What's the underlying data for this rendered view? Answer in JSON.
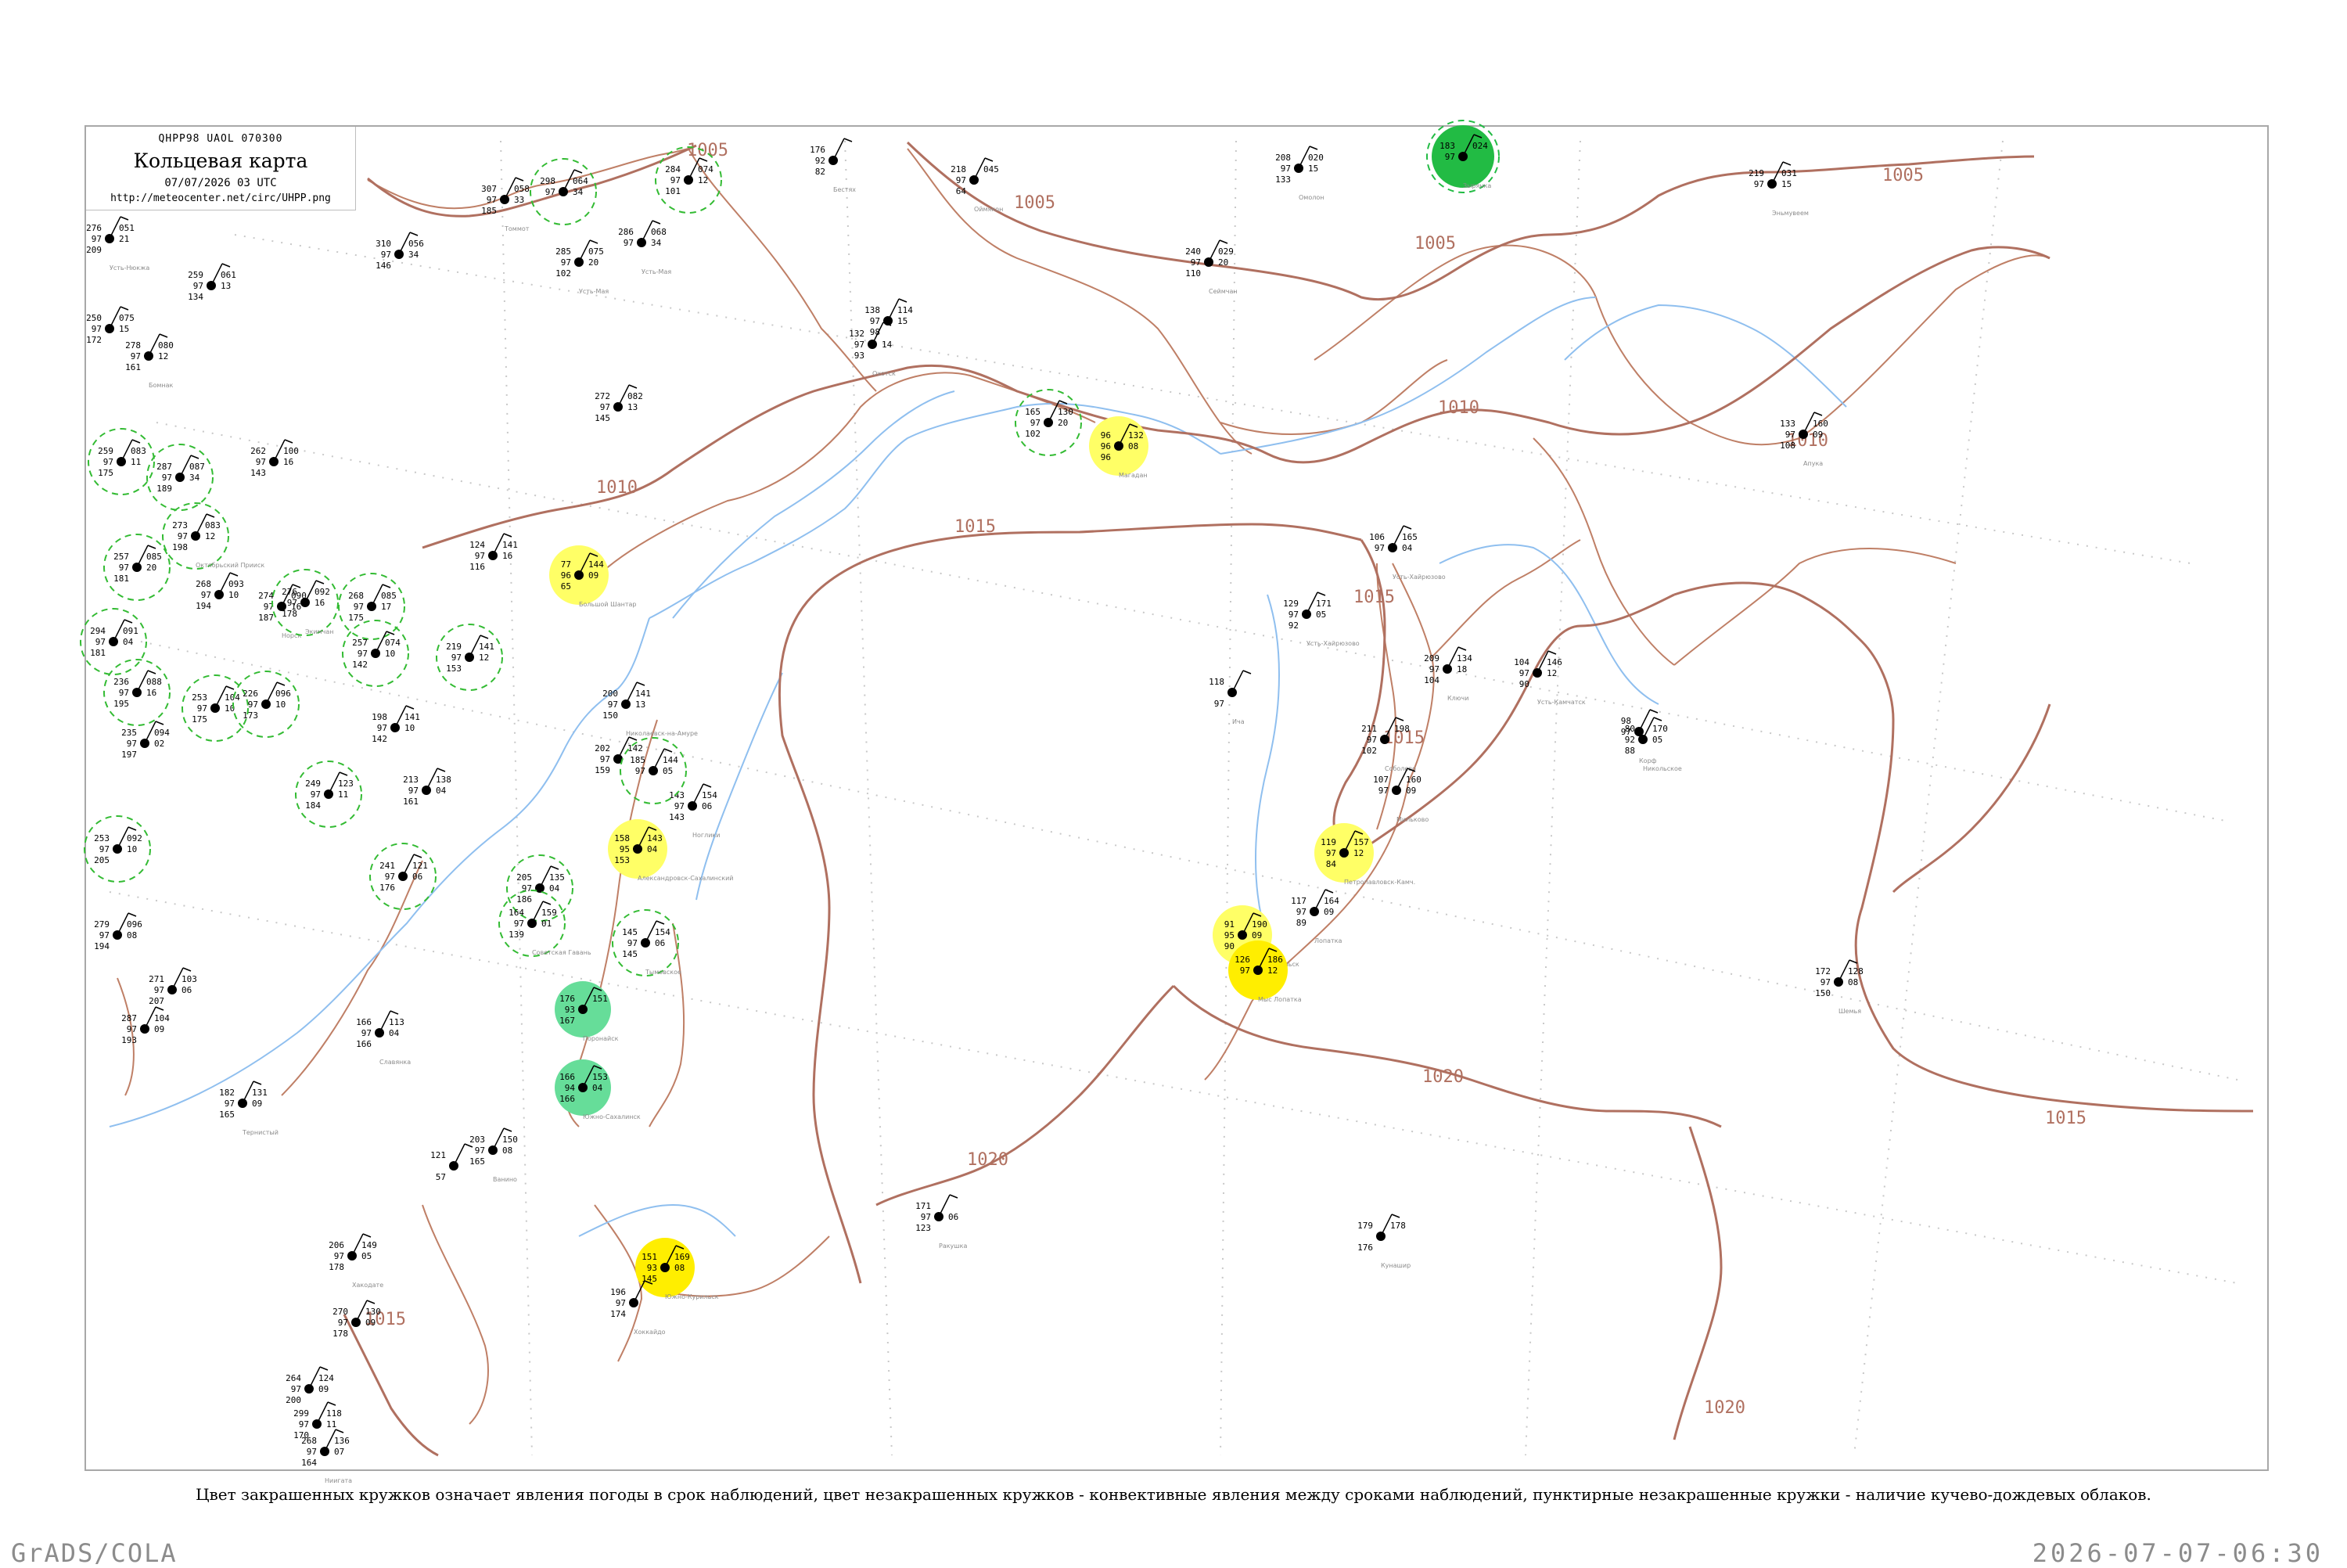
{
  "title": {
    "code": "QHPP98  UAOL  070300",
    "name": "Кольцевая карта",
    "date": "07/07/2026 03 UTC",
    "url": "http://meteocenter.net/circ/UHPP.png"
  },
  "caption": "Цвет закрашенных кружков означает явления погоды в срок наблюдений, цвет незакрашенных кружков - конвективные явления между сроками наблюдений, пунктирные незакрашенные кружки - наличие кучево-дождевых облаков.",
  "footer": {
    "left": "GrADS/COLA",
    "right": "2026-07-07-06:30"
  },
  "colors": {
    "isobar": "#b07060",
    "river": "#8fbfef",
    "coast": "#bf7f66",
    "dashed_circle": "#33bb33",
    "green_fill": "#22bb44",
    "mint_fill": "#66dd99",
    "yellow_fill": "#ffff66",
    "bright_yellow_fill": "#ffee00"
  },
  "isobar_labels": [
    "1005",
    "1005",
    "1005",
    "1005",
    "1010",
    "1010",
    "1010",
    "1015",
    "1015",
    "1015",
    "1015",
    "1015",
    "1020",
    "1020",
    "1015",
    "1020"
  ],
  "stations": [
    {
      "t": "276",
      "d": "97",
      "p": "209",
      "e": "051",
      "n": "21",
      "name": "Усть-Нюкжа"
    },
    {
      "t": "250",
      "d": "97",
      "p": "172",
      "e": "075",
      "n": "15",
      "name": ""
    },
    {
      "t": "259",
      "d": "97",
      "p": "134",
      "e": "061",
      "n": "13",
      "name": ""
    },
    {
      "t": "278",
      "d": "97",
      "p": "161",
      "e": "080",
      "n": "12",
      "name": "Бомнак"
    },
    {
      "t": "259",
      "d": "97",
      "p": "175",
      "e": "083",
      "n": "11",
      "name": ""
    },
    {
      "t": "287",
      "d": "97",
      "p": "189",
      "e": "087",
      "n": "34",
      "name": ""
    },
    {
      "t": "273",
      "d": "97",
      "p": "198",
      "e": "083",
      "n": "12",
      "name": "Октябрьский Прииск"
    },
    {
      "t": "257",
      "d": "97",
      "p": "181",
      "e": "085",
      "n": "20",
      "name": ""
    },
    {
      "t": "268",
      "d": "97",
      "p": "194",
      "e": "093",
      "n": "10",
      "name": ""
    },
    {
      "t": "274",
      "d": "97",
      "p": "187",
      "e": "090",
      "n": "16",
      "name": "Норск"
    },
    {
      "t": "276",
      "d": "97",
      "p": "178",
      "e": "092",
      "n": "16",
      "name": "Экимчан"
    },
    {
      "t": "268",
      "d": "97",
      "p": "175",
      "e": "085",
      "n": "17",
      "name": ""
    },
    {
      "t": "294",
      "d": "97",
      "p": "181",
      "e": "091",
      "n": "04",
      "name": ""
    },
    {
      "t": "236",
      "d": "97",
      "p": "195",
      "e": "088",
      "n": "16",
      "name": ""
    },
    {
      "t": "253",
      "d": "97",
      "p": "175",
      "e": "104",
      "n": "10",
      "name": ""
    },
    {
      "t": "226",
      "d": "97",
      "p": "173",
      "e": "096",
      "n": "10",
      "name": ""
    },
    {
      "t": "257",
      "d": "97",
      "p": "142",
      "e": "074",
      "n": "10",
      "name": ""
    },
    {
      "t": "219",
      "d": "97",
      "p": "153",
      "e": "141",
      "n": "12",
      "name": ""
    },
    {
      "t": "235",
      "d": "97",
      "p": "197",
      "e": "094",
      "n": "02",
      "name": ""
    },
    {
      "t": "198",
      "d": "97",
      "p": "142",
      "e": "141",
      "n": "10",
      "name": ""
    },
    {
      "t": "253",
      "d": "97",
      "p": "205",
      "e": "092",
      "n": "10",
      "name": ""
    },
    {
      "t": "249",
      "d": "97",
      "p": "184",
      "e": "123",
      "n": "11",
      "name": ""
    },
    {
      "t": "241",
      "d": "97",
      "p": "176",
      "e": "121",
      "n": "06",
      "name": ""
    },
    {
      "t": "205",
      "d": "97",
      "p": "186",
      "e": "135",
      "n": "04",
      "name": ""
    },
    {
      "t": "213",
      "d": "97",
      "p": "161",
      "e": "138",
      "n": "04",
      "name": ""
    },
    {
      "t": "164",
      "d": "97",
      "p": "139",
      "e": "159",
      "n": "01",
      "name": "Советская Гавань"
    },
    {
      "t": "279",
      "d": "97",
      "p": "194",
      "e": "096",
      "n": "08",
      "name": ""
    },
    {
      "t": "271",
      "d": "97",
      "p": "207",
      "e": "103",
      "n": "06",
      "name": ""
    },
    {
      "t": "287",
      "d": "97",
      "p": "193",
      "e": "104",
      "n": "09",
      "name": ""
    },
    {
      "t": "166",
      "d": "97",
      "p": "166",
      "e": "113",
      "n": "04",
      "name": "Славянка"
    },
    {
      "t": "182",
      "d": "97",
      "p": "165",
      "e": "131",
      "n": "09",
      "name": "Тернистый"
    },
    {
      "t": "124",
      "d": "97",
      "p": "116",
      "e": "141",
      "n": "16",
      "name": ""
    },
    {
      "t": "77",
      "d": "96",
      "p": "65",
      "e": "144",
      "n": "09",
      "name": "Большой Шантар"
    },
    {
      "t": "272",
      "d": "97",
      "p": "145",
      "e": "082",
      "n": "13",
      "name": ""
    },
    {
      "t": "262",
      "d": "97",
      "p": "143",
      "e": "100",
      "n": "16",
      "name": ""
    },
    {
      "t": "284",
      "d": "97",
      "p": "101",
      "e": "074",
      "n": "12",
      "name": ""
    },
    {
      "t": "298",
      "d": "97",
      "p": "",
      "e": "064",
      "n": "34",
      "name": ""
    },
    {
      "t": "307",
      "d": "97",
      "p": "185",
      "e": "058",
      "n": "33",
      "name": "Томмот"
    },
    {
      "t": "285",
      "d": "97",
      "p": "102",
      "e": "075",
      "n": "20",
      "name": "Усть-Мая"
    },
    {
      "t": "286",
      "d": "97",
      "p": "",
      "e": "068",
      "n": "34",
      "name": "Усть-Мая"
    },
    {
      "t": "310",
      "d": "97",
      "p": "146",
      "e": "056",
      "n": "34",
      "name": ""
    },
    {
      "t": "176",
      "d": "92",
      "p": "82",
      "e": "",
      "n": "",
      "name": "Бестях"
    },
    {
      "t": "218",
      "d": "97",
      "p": "64",
      "e": "045",
      "n": "",
      "name": "Оймякон"
    },
    {
      "t": "138",
      "d": "97",
      "p": "98",
      "e": "114",
      "n": "15",
      "name": ""
    },
    {
      "t": "132",
      "d": "97",
      "p": "93",
      "e": "",
      "n": "14",
      "name": "Охотск"
    },
    {
      "t": "165",
      "d": "97",
      "p": "102",
      "e": "130",
      "n": "20",
      "name": ""
    },
    {
      "t": "96",
      "d": "96",
      "p": "96",
      "e": "132",
      "n": "08",
      "name": "Магадан"
    },
    {
      "t": "208",
      "d": "97",
      "p": "133",
      "e": "020",
      "n": "15",
      "name": "Омолон"
    },
    {
      "t": "240",
      "d": "97",
      "p": "110",
      "e": "029",
      "n": "20",
      "name": "Сеймчан"
    },
    {
      "t": "183",
      "d": "97",
      "p": "",
      "e": "024",
      "n": "",
      "name": "Зырянка"
    },
    {
      "t": "219",
      "d": "97",
      "p": "",
      "e": "031",
      "n": "15",
      "name": "Эньмувеем"
    },
    {
      "t": "133",
      "d": "97",
      "p": "108",
      "e": "160",
      "n": "09",
      "name": "Апука"
    },
    {
      "t": "106",
      "d": "97",
      "p": "",
      "e": "165",
      "n": "04",
      "name": "Усть-Хайрюзово"
    },
    {
      "t": "129",
      "d": "97",
      "p": "92",
      "e": "171",
      "n": "05",
      "name": "Усть-Хайрюзово"
    },
    {
      "t": "118",
      "d": "",
      "p": "97",
      "e": "",
      "n": "",
      "name": "Ича"
    },
    {
      "t": "209",
      "d": "97",
      "p": "104",
      "e": "134",
      "n": "18",
      "name": "Ключи"
    },
    {
      "t": "104",
      "d": "97",
      "p": "90",
      "e": "146",
      "n": "12",
      "name": "Усть-Камчатск"
    },
    {
      "t": "211",
      "d": "97",
      "p": "102",
      "e": "198",
      "n": "",
      "name": "Соболево"
    },
    {
      "t": "107",
      "d": "97",
      "p": "",
      "e": "160",
      "n": "09",
      "name": "Мильково"
    },
    {
      "t": "119",
      "d": "97",
      "p": "84",
      "e": "157",
      "n": "12",
      "name": "Петропавловск-Камч."
    },
    {
      "t": "98",
      "d": "97",
      "p": "",
      "e": "",
      "n": "",
      "name": "Корф"
    },
    {
      "t": "80",
      "d": "92",
      "p": "88",
      "e": "170",
      "n": "05",
      "name": "Никольское"
    },
    {
      "t": "117",
      "d": "97",
      "p": "89",
      "e": "164",
      "n": "09",
      "name": "Лопатка"
    },
    {
      "t": "91",
      "d": "95",
      "p": "90",
      "e": "190",
      "n": "09",
      "name": "Северо-Курильск"
    },
    {
      "t": "126",
      "d": "97",
      "p": "",
      "e": "186",
      "n": "12",
      "name": "Мыс Лопатка"
    },
    {
      "t": "172",
      "d": "97",
      "p": "150",
      "e": "128",
      "n": "08",
      "name": "Шемья"
    },
    {
      "t": "171",
      "d": "97",
      "p": "123",
      "e": "",
      "n": "06",
      "name": "Ракушка"
    },
    {
      "t": "179",
      "d": "",
      "p": "176",
      "e": "178",
      "n": "",
      "name": "Кунашир"
    },
    {
      "t": "151",
      "d": "93",
      "p": "145",
      "e": "169",
      "n": "08",
      "name": "Южно-Курильск"
    },
    {
      "t": "196",
      "d": "97",
      "p": "174",
      "e": "",
      "n": "",
      "name": "Хоккайдо"
    },
    {
      "t": "176",
      "d": "93",
      "p": "167",
      "e": "151",
      "n": "",
      "name": "Поронайск"
    },
    {
      "t": "166",
      "d": "94",
      "p": "166",
      "e": "153",
      "n": "04",
      "name": "Южно-Сахалинск"
    },
    {
      "t": "145",
      "d": "97",
      "p": "145",
      "e": "154",
      "n": "06",
      "name": "Тымовское"
    },
    {
      "t": "158",
      "d": "95",
      "p": "153",
      "e": "143",
      "n": "04",
      "name": "Александровск-Сахалинский"
    },
    {
      "t": "143",
      "d": "97",
      "p": "143",
      "e": "154",
      "n": "06",
      "name": "Ноглики"
    },
    {
      "t": "200",
      "d": "97",
      "p": "150",
      "e": "141",
      "n": "13",
      "name": "Николаевск-на-Амуре"
    },
    {
      "t": "202",
      "d": "97",
      "p": "159",
      "e": "142",
      "n": "",
      "name": ""
    },
    {
      "t": "185",
      "d": "97",
      "p": "",
      "e": "144",
      "n": "05",
      "name": ""
    },
    {
      "t": "203",
      "d": "97",
      "p": "165",
      "e": "150",
      "n": "08",
      "name": "Ванино"
    },
    {
      "t": "121",
      "d": "",
      "p": "57",
      "e": "",
      "n": "",
      "name": ""
    },
    {
      "t": "206",
      "d": "97",
      "p": "178",
      "e": "149",
      "n": "05",
      "name": "Хакодате"
    },
    {
      "t": "270",
      "d": "97",
      "p": "178",
      "e": "130",
      "n": "09",
      "name": ""
    },
    {
      "t": "264",
      "d": "97",
      "p": "200",
      "e": "124",
      "n": "09",
      "name": ""
    },
    {
      "t": "299",
      "d": "97",
      "p": "170",
      "e": "118",
      "n": "11",
      "name": ""
    },
    {
      "t": "268",
      "d": "97",
      "p": "164",
      "e": "136",
      "n": "07",
      "name": "Ниигата"
    }
  ]
}
